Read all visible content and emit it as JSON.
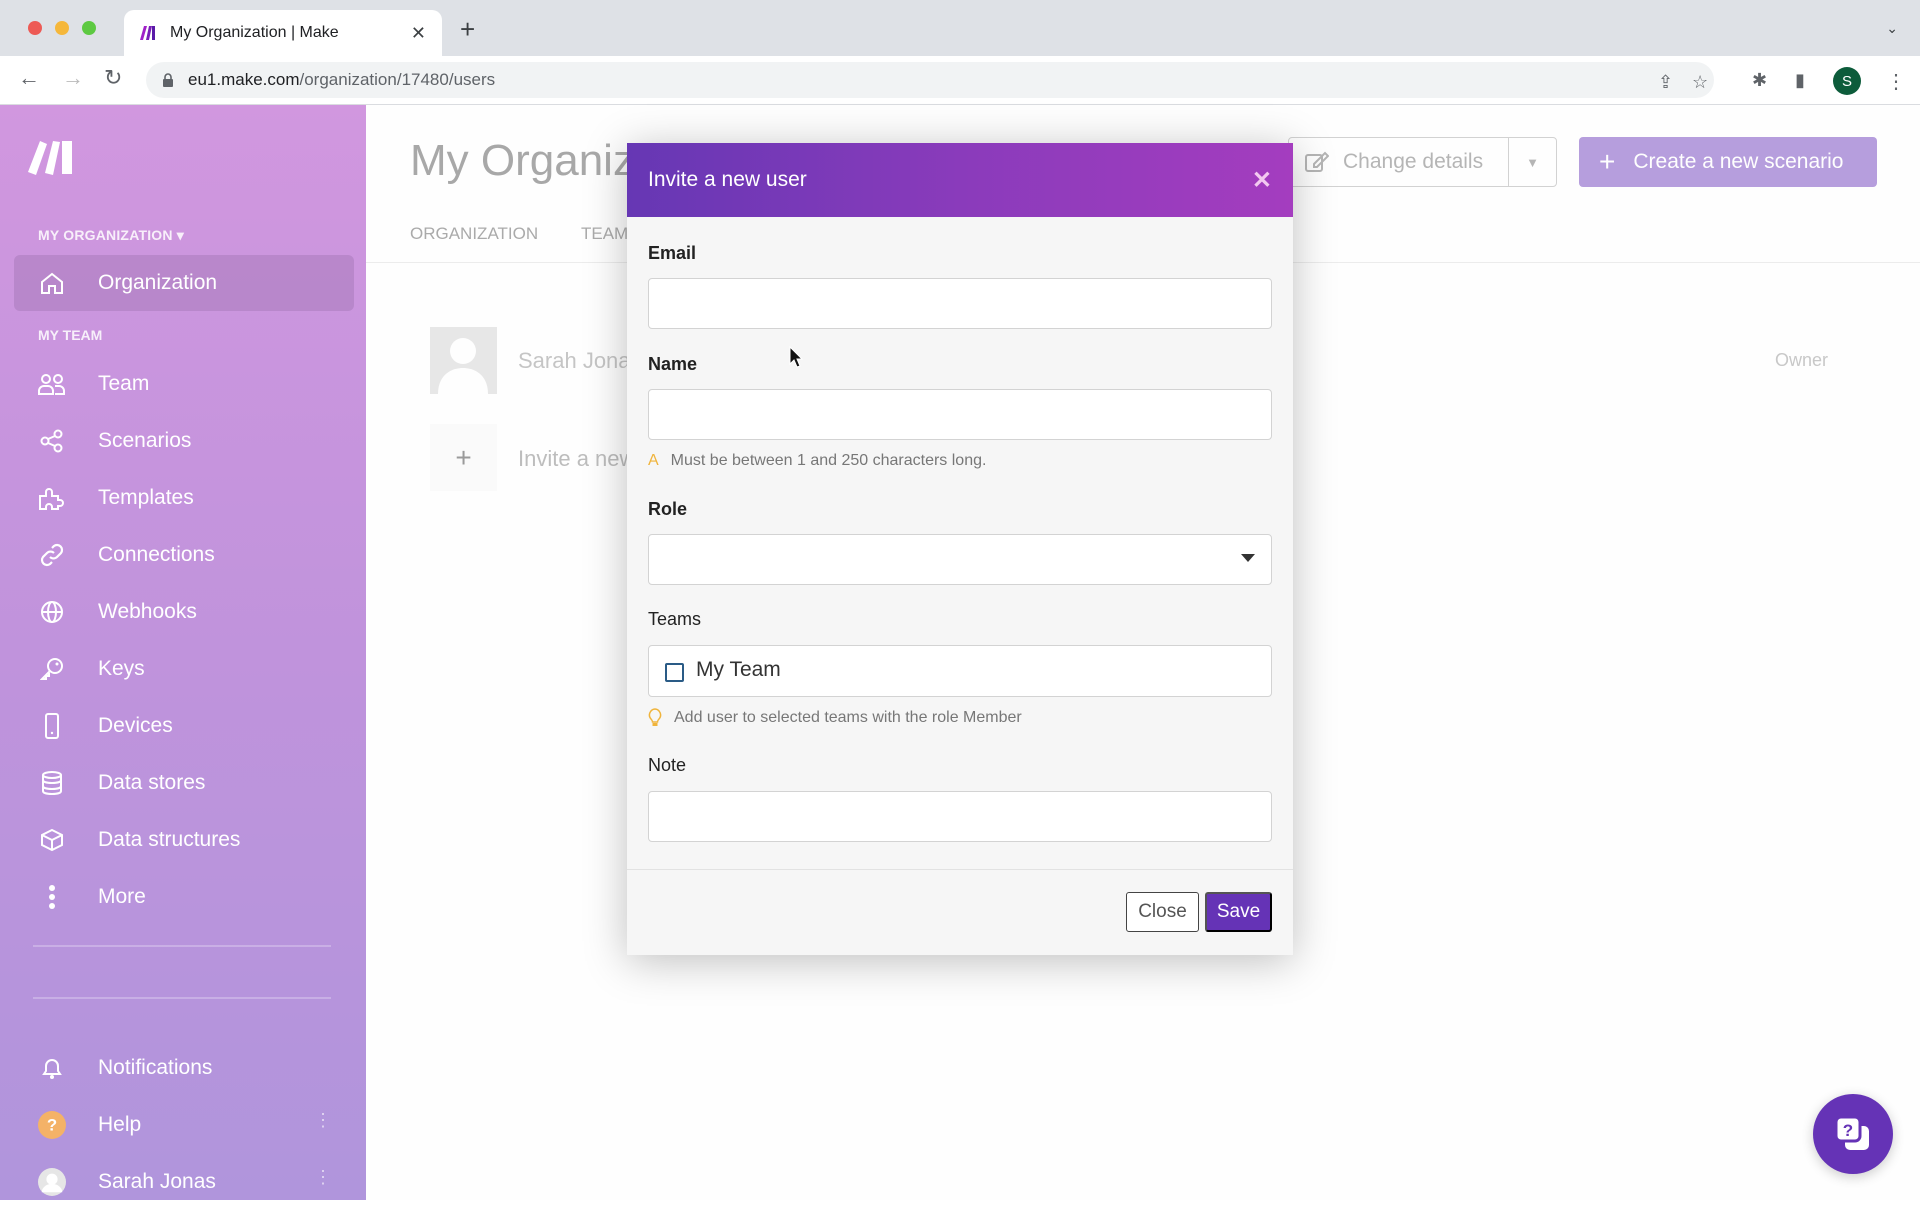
{
  "browser": {
    "tab_title": "My Organization | Make",
    "url_host": "eu1.make.com",
    "url_path": "/organization/17480/users",
    "profile_initial": "S",
    "icons": [
      "back-icon",
      "forward-icon",
      "reload-icon",
      "lock-icon",
      "share-icon",
      "star-icon",
      "extensions-icon",
      "sidepanel-icon",
      "menu-icon"
    ]
  },
  "sidebar": {
    "org_section": "MY ORGANIZATION",
    "team_section": "MY TEAM",
    "org_item": {
      "label": "Organization",
      "icon": "home-icon",
      "active": true
    },
    "items": [
      {
        "label": "Team",
        "icon": "team-icon"
      },
      {
        "label": "Scenarios",
        "icon": "share-nodes-icon"
      },
      {
        "label": "Templates",
        "icon": "puzzle-icon"
      },
      {
        "label": "Connections",
        "icon": "link-icon"
      },
      {
        "label": "Webhooks",
        "icon": "globe-icon"
      },
      {
        "label": "Keys",
        "icon": "key-icon"
      },
      {
        "label": "Devices",
        "icon": "mobile-icon"
      },
      {
        "label": "Data stores",
        "icon": "database-icon"
      },
      {
        "label": "Data structures",
        "icon": "cube-icon"
      },
      {
        "label": "More",
        "icon": "more-vertical-icon"
      }
    ],
    "bottom": [
      {
        "label": "Notifications",
        "icon": "bell-icon"
      },
      {
        "label": "Help",
        "icon": "help-icon"
      },
      {
        "label": "Sarah Jonas",
        "icon": "avatar-icon"
      }
    ]
  },
  "main": {
    "title": "My Organization",
    "tabs": [
      "ORGANIZATION",
      "TEAMS"
    ],
    "change_details": "Change details",
    "create_scenario": "Create a new scenario",
    "users": [
      {
        "name": "Sarah Jonas",
        "role": "Owner"
      }
    ],
    "invite_label": "Invite a new user"
  },
  "modal": {
    "title": "Invite a new user",
    "email_label": "Email",
    "email_value": "",
    "name_label": "Name",
    "name_value": "",
    "name_hint": "Must be between 1 and 250 characters long.",
    "role_label": "Role",
    "role_value": "",
    "teams_label": "Teams",
    "teams": [
      {
        "label": "My Team",
        "checked": false
      }
    ],
    "teams_hint": "Add user to selected teams with the role Member",
    "note_label": "Note",
    "note_value": "",
    "close_label": "Close",
    "save_label": "Save"
  },
  "colors": {
    "accent": "#6533b6",
    "header_gradient_start": "#6637b4",
    "header_gradient_end": "#a43dbf",
    "sidebar_top": "#d197df",
    "sidebar_bottom": "#b095dc",
    "warning": "#f0b43c"
  }
}
